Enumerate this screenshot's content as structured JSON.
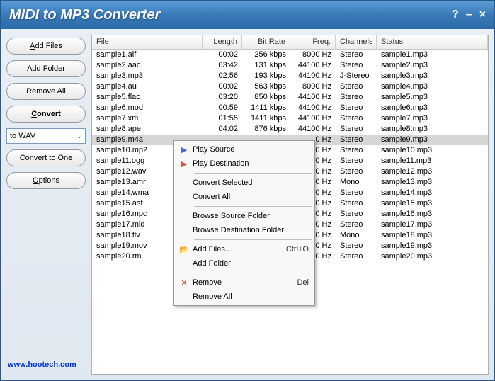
{
  "titlebar": {
    "title": "MIDI to MP3 Converter"
  },
  "sidebar": {
    "add_files": "Add Files",
    "add_folder": "Add Folder",
    "remove_all": "Remove All",
    "convert": "Convert",
    "format_select": "to WAV",
    "convert_to_one": "Convert to One",
    "options": "Options"
  },
  "footer": {
    "link": "www.hootech.com"
  },
  "columns": {
    "file": "File",
    "length": "Length",
    "bitrate": "Bit Rate",
    "freq": "Freq.",
    "channels": "Channels",
    "status": "Status"
  },
  "rows": [
    {
      "file": "sample1.aif",
      "length": "00:02",
      "bitrate": "256 kbps",
      "freq": "8000 Hz",
      "channels": "Stereo",
      "status": "sample1.mp3"
    },
    {
      "file": "sample2.aac",
      "length": "03:42",
      "bitrate": "131 kbps",
      "freq": "44100 Hz",
      "channels": "Stereo",
      "status": "sample2.mp3"
    },
    {
      "file": "sample3.mp3",
      "length": "02:56",
      "bitrate": "193 kbps",
      "freq": "44100 Hz",
      "channels": "J-Stereo",
      "status": "sample3.mp3"
    },
    {
      "file": "sample4.au",
      "length": "00:02",
      "bitrate": "563 kbps",
      "freq": "8000 Hz",
      "channels": "Stereo",
      "status": "sample4.mp3"
    },
    {
      "file": "sample5.flac",
      "length": "03:20",
      "bitrate": "850 kbps",
      "freq": "44100 Hz",
      "channels": "Stereo",
      "status": "sample5.mp3"
    },
    {
      "file": "sample6.mod",
      "length": "00:59",
      "bitrate": "1411 kbps",
      "freq": "44100 Hz",
      "channels": "Stereo",
      "status": "sample6.mp3"
    },
    {
      "file": "sample7.xm",
      "length": "01:55",
      "bitrate": "1411 kbps",
      "freq": "44100 Hz",
      "channels": "Stereo",
      "status": "sample7.mp3"
    },
    {
      "file": "sample8.ape",
      "length": "04:02",
      "bitrate": "876 kbps",
      "freq": "44100 Hz",
      "channels": "Stereo",
      "status": "sample8.mp3"
    },
    {
      "file": "sample9.m4a",
      "length": "",
      "bitrate": "",
      "freq": "0 Hz",
      "channels": "Stereo",
      "status": "sample9.mp3",
      "selected": true
    },
    {
      "file": "sample10.mp2",
      "length": "",
      "bitrate": "",
      "freq": "0 Hz",
      "channels": "Stereo",
      "status": "sample10.mp3"
    },
    {
      "file": "sample11.ogg",
      "length": "",
      "bitrate": "",
      "freq": "0 Hz",
      "channels": "Stereo",
      "status": "sample11.mp3"
    },
    {
      "file": "sample12.wav",
      "length": "",
      "bitrate": "",
      "freq": "0 Hz",
      "channels": "Stereo",
      "status": "sample12.mp3"
    },
    {
      "file": "sample13.amr",
      "length": "",
      "bitrate": "",
      "freq": "0 Hz",
      "channels": "Mono",
      "status": "sample13.mp3"
    },
    {
      "file": "sample14.wma",
      "length": "",
      "bitrate": "",
      "freq": "0 Hz",
      "channels": "Stereo",
      "status": "sample14.mp3"
    },
    {
      "file": "sample15.asf",
      "length": "",
      "bitrate": "",
      "freq": "0 Hz",
      "channels": "Stereo",
      "status": "sample15.mp3"
    },
    {
      "file": "sample16.mpc",
      "length": "",
      "bitrate": "",
      "freq": "0 Hz",
      "channels": "Stereo",
      "status": "sample16.mp3"
    },
    {
      "file": "sample17.mid",
      "length": "",
      "bitrate": "",
      "freq": "0 Hz",
      "channels": "Stereo",
      "status": "sample17.mp3"
    },
    {
      "file": "sample18.flv",
      "length": "",
      "bitrate": "",
      "freq": "0 Hz",
      "channels": "Mono",
      "status": "sample18.mp3"
    },
    {
      "file": "sample19.mov",
      "length": "",
      "bitrate": "",
      "freq": "0 Hz",
      "channels": "Stereo",
      "status": "sample19.mp3"
    },
    {
      "file": "sample20.rm",
      "length": "",
      "bitrate": "",
      "freq": "0 Hz",
      "channels": "Stereo",
      "status": "sample20.mp3"
    }
  ],
  "context_menu": {
    "play_source": "Play Source",
    "play_destination": "Play Destination",
    "convert_selected": "Convert Selected",
    "convert_all": "Convert All",
    "browse_source": "Browse Source Folder",
    "browse_dest": "Browse Destination Folder",
    "add_files": "Add Files...",
    "add_files_shortcut": "Ctrl+O",
    "add_folder": "Add Folder",
    "remove": "Remove",
    "remove_shortcut": "Del",
    "remove_all": "Remove All"
  }
}
